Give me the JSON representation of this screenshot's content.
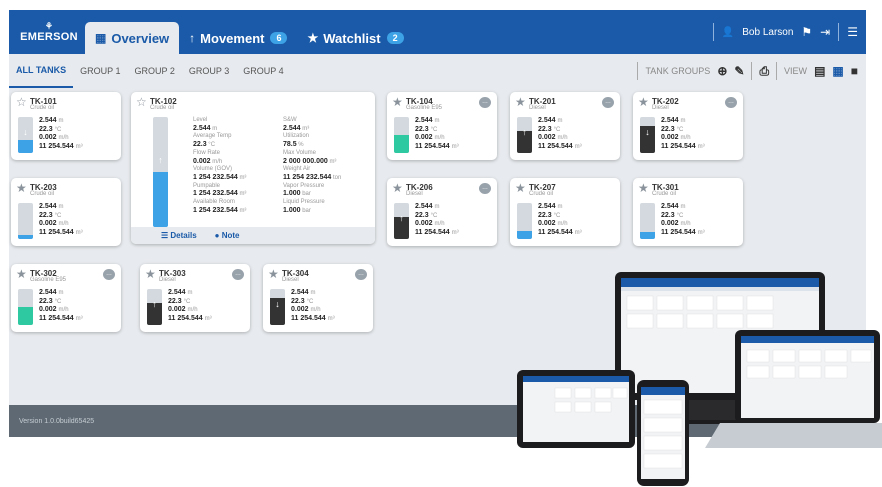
{
  "header": {
    "logo": "EMERSON",
    "tabs": [
      {
        "label": "Overview",
        "icon": "grid-icon",
        "active": true
      },
      {
        "label": "Movement",
        "icon": "arrow-up-icon",
        "badge": "6"
      },
      {
        "label": "Watchlist",
        "icon": "star-icon",
        "badge": "2"
      }
    ],
    "user": "Bob Larson"
  },
  "groups": {
    "tabs": [
      "ALL TANKS",
      "GROUP 1",
      "GROUP 2",
      "GROUP 3",
      "GROUP 4"
    ],
    "tank_groups": "TANK GROUPS",
    "view": "VIEW"
  },
  "units": {
    "level": "m",
    "temp": "°C",
    "flow": "m/h",
    "volume": "m³"
  },
  "tanks": [
    {
      "id": "TK-101",
      "product": "Crude oil",
      "level": "2.544",
      "temp": "22.3",
      "flow": "0.002",
      "volume": "11 254.544",
      "fill": 0.35,
      "color": "#3da2e6",
      "arrow": "↓",
      "favorite": false
    },
    {
      "id": "TK-104",
      "product": "Gasoline E95",
      "level": "2.544",
      "temp": "22.3",
      "flow": "0.002",
      "volume": "11 254.544",
      "fill": 0.5,
      "color": "#2ec9a0",
      "arrow": "",
      "favorite": true
    },
    {
      "id": "TK-201",
      "product": "Diesel",
      "level": "2.544",
      "temp": "22.3",
      "flow": "0.002",
      "volume": "11 254.544",
      "fill": 0.6,
      "color": "#333333",
      "arrow": "↑",
      "favorite": true
    },
    {
      "id": "TK-202",
      "product": "Diesel",
      "level": "2.544",
      "temp": "22.3",
      "flow": "0.002",
      "volume": "11 254.544",
      "fill": 0.75,
      "color": "#333333",
      "arrow": "↓",
      "favorite": true
    },
    {
      "id": "TK-203",
      "product": "Crude oil",
      "level": "2.544",
      "temp": "22.3",
      "flow": "0.002",
      "volume": "11 254.544",
      "fill": 0.12,
      "color": "#3da2e6",
      "arrow": "",
      "favorite": true
    },
    {
      "id": "TK-206",
      "product": "Diesel",
      "level": "2.544",
      "temp": "22.3",
      "flow": "0.002",
      "volume": "11 254.544",
      "fill": 0.6,
      "color": "#333333",
      "arrow": "↑",
      "favorite": true
    },
    {
      "id": "TK-207",
      "product": "Crude oil",
      "level": "2.544",
      "temp": "22.3",
      "flow": "0.002",
      "volume": "11 254.544",
      "fill": 0.22,
      "color": "#3da2e6",
      "arrow": "",
      "favorite": true
    },
    {
      "id": "TK-301",
      "product": "Crude oil",
      "level": "2.544",
      "temp": "22.3",
      "flow": "0.002",
      "volume": "11 254.544",
      "fill": 0.2,
      "color": "#3da2e6",
      "arrow": "",
      "favorite": true
    },
    {
      "id": "TK-302",
      "product": "Gasoline E95",
      "level": "2.544",
      "temp": "22.3",
      "flow": "0.002",
      "volume": "11 254.544",
      "fill": 0.5,
      "color": "#2ec9a0",
      "arrow": "",
      "favorite": true
    },
    {
      "id": "TK-303",
      "product": "Diesel",
      "level": "2.544",
      "temp": "22.3",
      "flow": "0.002",
      "volume": "11 254.544",
      "fill": 0.6,
      "color": "#333333",
      "arrow": "↑",
      "favorite": true
    },
    {
      "id": "TK-304",
      "product": "Diesel",
      "level": "2.544",
      "temp": "22.3",
      "flow": "0.002",
      "volume": "11 254.544",
      "fill": 0.75,
      "color": "#333333",
      "arrow": "↓",
      "favorite": true
    }
  ],
  "expanded": {
    "id": "TK-102",
    "product": "Crude oil",
    "fill": 0.5,
    "color": "#3da2e6",
    "left": [
      [
        "Level",
        "2.544",
        "m"
      ],
      [
        "Average Temp",
        "22.3",
        "°C"
      ],
      [
        "Flow Rate",
        "0.002",
        "m/h"
      ],
      [
        "Volume (GOV)",
        "1 254 232.544",
        "m³"
      ],
      [
        "Pumpable",
        "1 254 232.544",
        "m³"
      ],
      [
        "Available Room",
        "1 254 232.544",
        "m³"
      ]
    ],
    "right": [
      [
        "S&W",
        "2.544",
        "m³"
      ],
      [
        "Utilization",
        "78.5",
        "%"
      ],
      [
        "Max Volume",
        "2 000 000.000",
        "m³"
      ],
      [
        "Weight Air",
        "11 254 232.544",
        "ton"
      ],
      [
        "Vapor Pressure",
        "1.000",
        "bar"
      ],
      [
        "Liquid Pressure",
        "1.000",
        "bar"
      ]
    ],
    "details": "Details",
    "note": "Note"
  },
  "footer": {
    "version": "Version 1.0.0build65425"
  }
}
